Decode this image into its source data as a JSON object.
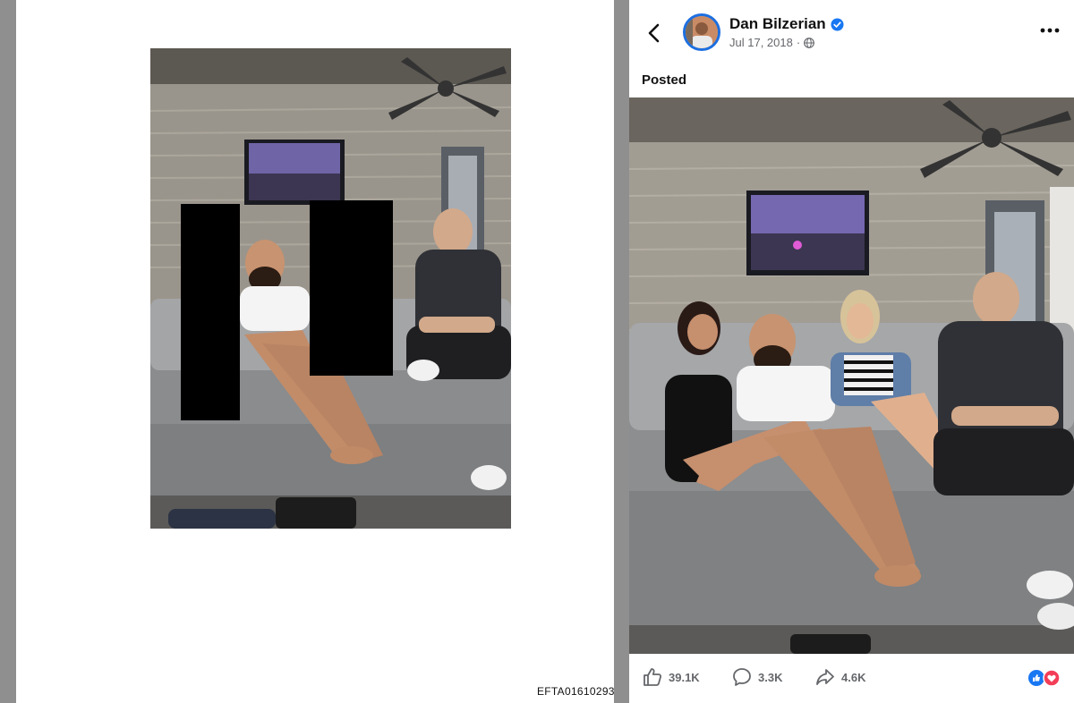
{
  "document": {
    "doc_id": "EFTA01610293"
  },
  "post": {
    "author": "Dan Bilzerian",
    "date": "Jul 17, 2018",
    "post_type": "Posted",
    "stats": {
      "likes": "39.1K",
      "comments": "3.3K",
      "shares": "4.6K"
    }
  },
  "icons": {
    "back": "chevron-left-icon",
    "verified": "verified-badge-icon",
    "audience": "globe-icon",
    "more": "more-options-icon",
    "like": "thumbs-up-icon",
    "comment": "comment-bubble-icon",
    "share": "share-arrow-icon",
    "reactions": "like-love-reactions-icon"
  },
  "colors": {
    "accent": "#1877f2",
    "love": "#f33e58",
    "text_secondary": "#65676b",
    "redaction": "#000000"
  }
}
